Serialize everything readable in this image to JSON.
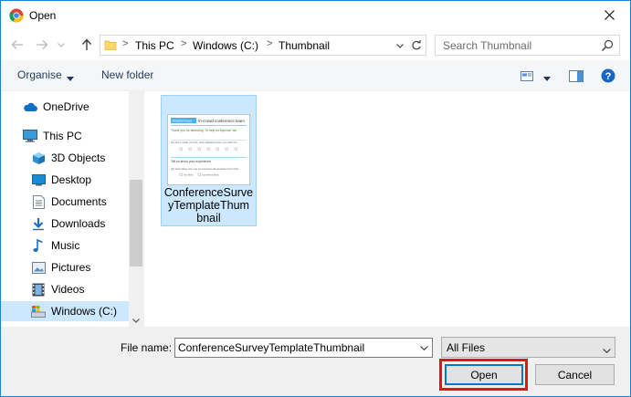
{
  "window": {
    "title": "Open"
  },
  "address": {
    "crumbs": [
      "This PC",
      "Windows (C:)",
      "Thumbnail"
    ],
    "separator": ">"
  },
  "search": {
    "placeholder": "Search Thumbnail"
  },
  "toolbar": {
    "organise": "Organise",
    "new_folder": "New folder"
  },
  "sidebar": {
    "items": [
      {
        "label": "OneDrive",
        "icon": "cloud-icon"
      },
      {
        "label": "This PC",
        "icon": "computer-icon"
      },
      {
        "label": "3D Objects",
        "icon": "cube-icon"
      },
      {
        "label": "Desktop",
        "icon": "desktop-icon"
      },
      {
        "label": "Documents",
        "icon": "document-icon"
      },
      {
        "label": "Downloads",
        "icon": "download-arrow-icon"
      },
      {
        "label": "Music",
        "icon": "music-note-icon"
      },
      {
        "label": "Pictures",
        "icon": "picture-icon"
      },
      {
        "label": "Videos",
        "icon": "film-icon"
      },
      {
        "label": "Windows (C:)",
        "icon": "drive-icon",
        "selected": true
      }
    ]
  },
  "files": [
    {
      "name": "ConferenceSurveyTemplateThumbnail",
      "name_lines": [
        "ConferenceSurve",
        "yTemplateThum",
        "bnail"
      ],
      "thumbnail": {
        "brand": "SnapSurveys",
        "heading": "In-crowd conference team",
        "intro": "Thank you for attending. To help us improve, we",
        "q1": "Q1  On a scale of 0-10, how satisfied were you with the",
        "section": "Tell us about your experience",
        "q2": "Q2  How likely are you to recommend sessions from this",
        "opt1": "Not likely",
        "opt2": "Somewhat likely"
      }
    }
  ],
  "bottom": {
    "file_name_label": "File name:",
    "file_name_value": "ConferenceSurveyTemplateThumbnail",
    "filter": "All Files",
    "open": "Open",
    "cancel": "Cancel"
  },
  "colors": {
    "accent": "#0078d7",
    "selection": "#cce8ff",
    "highlight": "#e3141e"
  }
}
